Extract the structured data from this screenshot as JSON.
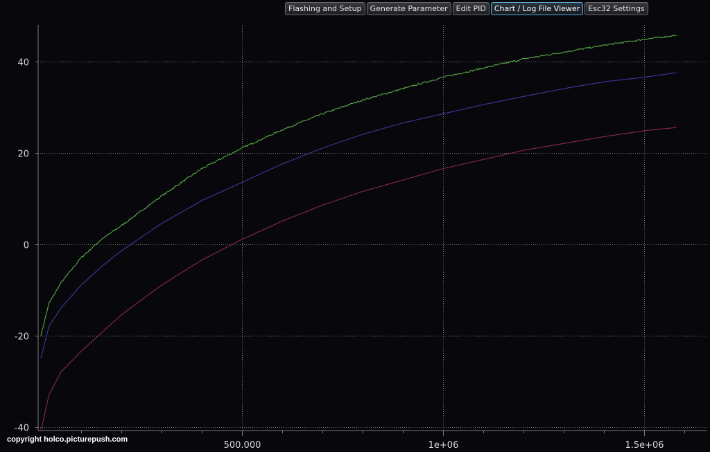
{
  "tabs": [
    {
      "label": "Flashing and Setup",
      "active": false
    },
    {
      "label": "Generate Parameter",
      "active": false
    },
    {
      "label": "Edit PID",
      "active": false
    },
    {
      "label": "Chart / Log File Viewer",
      "active": true
    },
    {
      "label": "Esc32 Settings",
      "active": false
    }
  ],
  "watermark": "copyright holco.picturepush.com",
  "colors": {
    "background": "#08080c",
    "grid": "#7a7a7a",
    "axis_text": "#d8d8d8",
    "active_tab_border": "#5ab4e8"
  },
  "chart_data": {
    "type": "line",
    "title": "",
    "xlabel": "",
    "ylabel": "",
    "xlim": [
      0,
      1660000
    ],
    "ylim": [
      -41,
      48
    ],
    "x_ticks": [
      500000,
      1000000,
      1500000
    ],
    "x_tick_labels": [
      "500.000",
      "1e+06",
      "1.5e+06"
    ],
    "y_ticks": [
      -40,
      -20,
      0,
      20,
      40
    ],
    "y_tick_labels": [
      "-40",
      "-20",
      "0",
      "20",
      "40"
    ],
    "grid": true,
    "legend": "none",
    "series": [
      {
        "color": "#5aa84a",
        "noisy": true,
        "x": [
          0,
          20000,
          50000,
          100000,
          150000,
          200000,
          300000,
          400000,
          500000,
          600000,
          700000,
          800000,
          900000,
          1000000,
          1100000,
          1200000,
          1300000,
          1400000,
          1500000,
          1580000
        ],
        "y": [
          -20,
          -13,
          -8.5,
          -3,
          1,
          4,
          10.5,
          16.5,
          21,
          25,
          28.5,
          31.5,
          34,
          36.5,
          38.5,
          40.5,
          42,
          43.5,
          44.8,
          45.7
        ]
      },
      {
        "color": "#3a3aa0",
        "noisy": false,
        "x": [
          0,
          20000,
          50000,
          100000,
          150000,
          200000,
          300000,
          400000,
          500000,
          600000,
          700000,
          800000,
          900000,
          1000000,
          1100000,
          1200000,
          1300000,
          1400000,
          1500000,
          1580000
        ],
        "y": [
          -25,
          -18,
          -14,
          -9,
          -5,
          -1.5,
          4.5,
          9.5,
          13.5,
          17.5,
          21,
          24,
          26.5,
          28.5,
          30.5,
          32.3,
          34,
          35.5,
          36.5,
          37.5
        ]
      },
      {
        "color": "#8a2a42",
        "noisy": false,
        "x": [
          0,
          20000,
          50000,
          100000,
          150000,
          200000,
          300000,
          400000,
          500000,
          600000,
          700000,
          800000,
          900000,
          1000000,
          1100000,
          1200000,
          1300000,
          1400000,
          1500000,
          1580000
        ],
        "y": [
          -41,
          -33,
          -28,
          -23.5,
          -19.5,
          -15.5,
          -9,
          -3.5,
          1,
          5,
          8.5,
          11.5,
          14,
          16.5,
          18.5,
          20.5,
          22,
          23.5,
          24.8,
          25.5
        ]
      }
    ]
  }
}
